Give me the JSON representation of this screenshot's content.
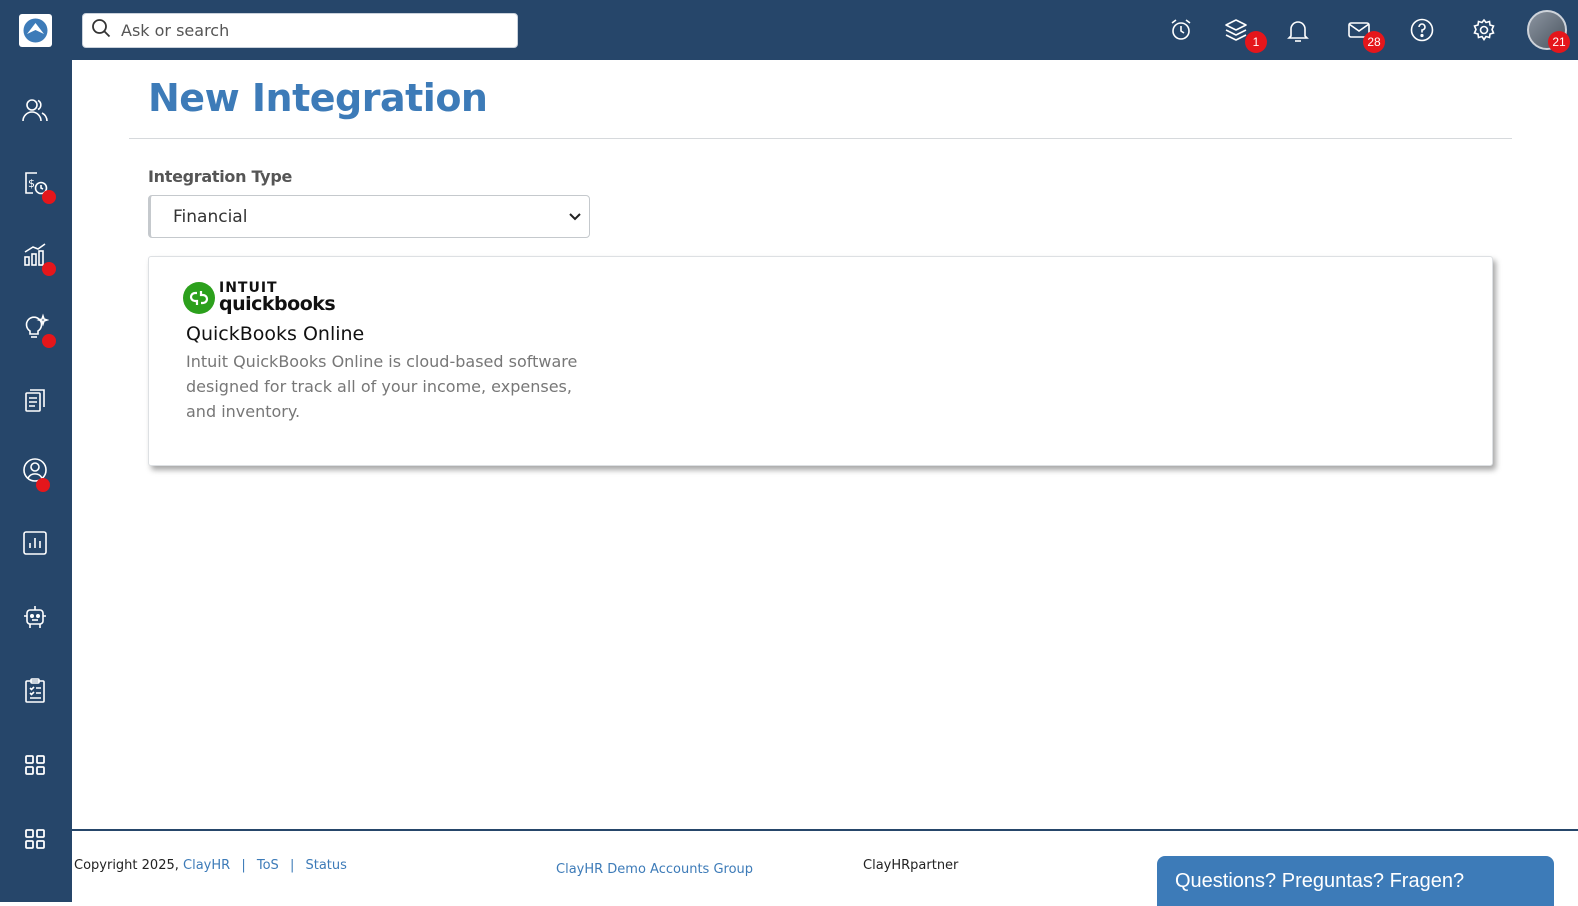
{
  "header": {
    "search_placeholder": "Ask or search",
    "icons": [
      {
        "name": "alarm-clock-icon",
        "badge": ""
      },
      {
        "name": "layers-icon",
        "badge": "1"
      },
      {
        "name": "bell-icon",
        "badge": ""
      },
      {
        "name": "mail-icon",
        "badge": "28"
      },
      {
        "name": "help-icon",
        "badge": ""
      },
      {
        "name": "gear-icon",
        "badge": ""
      }
    ],
    "avatar_badge": "21"
  },
  "sidebar": {
    "items": [
      {
        "name": "people-icon",
        "dot": false
      },
      {
        "name": "payroll-clock-icon",
        "dot": true
      },
      {
        "name": "growth-chart-icon",
        "dot": true
      },
      {
        "name": "lightbulb-icon",
        "dot": true
      },
      {
        "name": "documents-icon",
        "dot": false
      },
      {
        "name": "user-circle-icon",
        "dot": true
      },
      {
        "name": "bar-chart-icon",
        "dot": false
      },
      {
        "name": "bot-icon",
        "dot": false
      },
      {
        "name": "clipboard-icon",
        "dot": false
      },
      {
        "name": "apps-grid-icon",
        "dot": false
      },
      {
        "name": "apps-grid-icon",
        "dot": false
      }
    ]
  },
  "main": {
    "title": "New Integration",
    "integration_type_label": "Integration Type",
    "integration_type_value": "Financial",
    "card": {
      "logo_brand": "INTUIT",
      "logo_product": "quickbooks",
      "title": "QuickBooks Online",
      "description": "Intuit QuickBooks Online is cloud-based software designed for track all of your income, expenses, and inventory."
    }
  },
  "footer": {
    "copyright": "Copyright 2025,",
    "company_link": "ClayHR",
    "sep": "|",
    "tos": "ToS",
    "status": "Status",
    "group": "ClayHR Demo Accounts Group",
    "partner": "ClayHRpartner",
    "help_tab": "Questions? Preguntas? Fragen?"
  },
  "colors": {
    "nav_bg": "#26466a",
    "accent": "#3d7bb8",
    "badge": "#e5161b",
    "qb_green": "#2ca01c"
  }
}
